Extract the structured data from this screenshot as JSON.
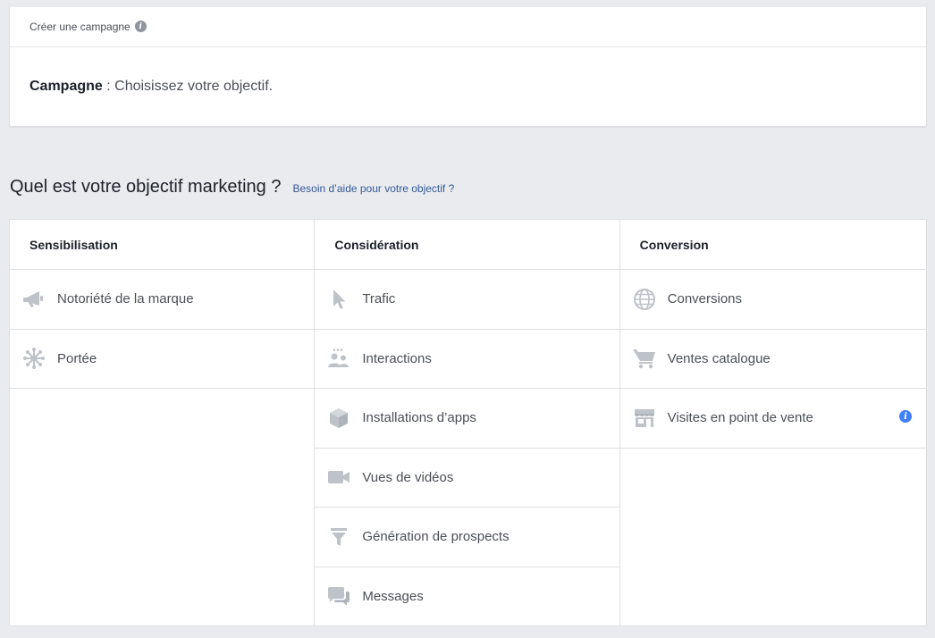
{
  "campaign": {
    "header_label": "Créer une campagne",
    "info_icon": "info-icon",
    "body_strong": "Campagne",
    "body_rest": " : Choisissez votre objectif."
  },
  "objective_section": {
    "title": "Quel est votre objectif marketing ?",
    "help_link": "Besoin d’aide pour votre objectif ?"
  },
  "colors": {
    "icon_gray": "#bec2c9",
    "link_blue": "#365899",
    "info_blue": "#4080ff",
    "border": "#dddfe2",
    "background": "#e9ebee"
  },
  "columns": [
    {
      "header": "Sensibilisation",
      "items": [
        {
          "label": "Notoriété de la marque",
          "icon": "megaphone-icon"
        },
        {
          "label": "Portée",
          "icon": "reach-icon"
        }
      ]
    },
    {
      "header": "Considération",
      "items": [
        {
          "label": "Trafic",
          "icon": "cursor-icon"
        },
        {
          "label": "Interactions",
          "icon": "people-icon"
        },
        {
          "label": "Installations d’apps",
          "icon": "box-icon"
        },
        {
          "label": "Vues de vidéos",
          "icon": "video-camera-icon"
        },
        {
          "label": "Génération de prospects",
          "icon": "funnel-icon"
        },
        {
          "label": "Messages",
          "icon": "chat-bubbles-icon"
        }
      ]
    },
    {
      "header": "Conversion",
      "items": [
        {
          "label": "Conversions",
          "icon": "globe-icon"
        },
        {
          "label": "Ventes catalogue",
          "icon": "shopping-cart-icon"
        },
        {
          "label": "Visites en point de vente",
          "icon": "storefront-icon",
          "info": "info-icon"
        }
      ]
    }
  ]
}
